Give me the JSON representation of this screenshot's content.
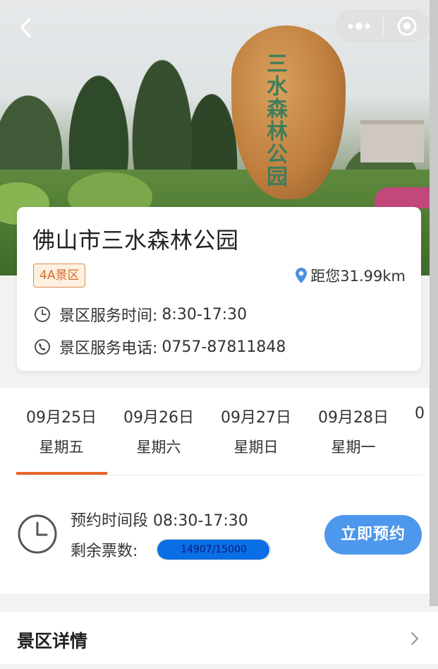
{
  "nav": {
    "back_icon": "chevron-left-icon",
    "more_icon": "more-dots-icon",
    "close_icon": "target-circle-icon"
  },
  "hero": {
    "rock_inscription": "三水森林公园"
  },
  "park": {
    "name": "佛山市三水森林公园",
    "grade": "4A景区",
    "distance": "距您31.99km",
    "hours_label": "景区服务时间:",
    "hours_value": "8:30-17:30",
    "phone_label": "景区服务电话:",
    "phone_value": "0757-87811848"
  },
  "dates": [
    {
      "date": "09月25日",
      "weekday": "星期五",
      "selected": true
    },
    {
      "date": "09月26日",
      "weekday": "星期六",
      "selected": false
    },
    {
      "date": "09月27日",
      "weekday": "星期日",
      "selected": false
    },
    {
      "date": "09月28日",
      "weekday": "星期一",
      "selected": false
    },
    {
      "date": "0",
      "weekday": "",
      "selected": false
    }
  ],
  "slot": {
    "time_label": "预约时间段 08:30-17:30",
    "remain_label": "剩余票数:",
    "remaining": 14907,
    "total": 15000,
    "remain_text": "14907/15000",
    "book_label": "立即预约"
  },
  "details": {
    "title": "景区详情"
  },
  "colors": {
    "accent": "#e8672a",
    "button": "#4d97ec",
    "progress": "#0a6ee6",
    "badge_text": "#d26d2b"
  }
}
